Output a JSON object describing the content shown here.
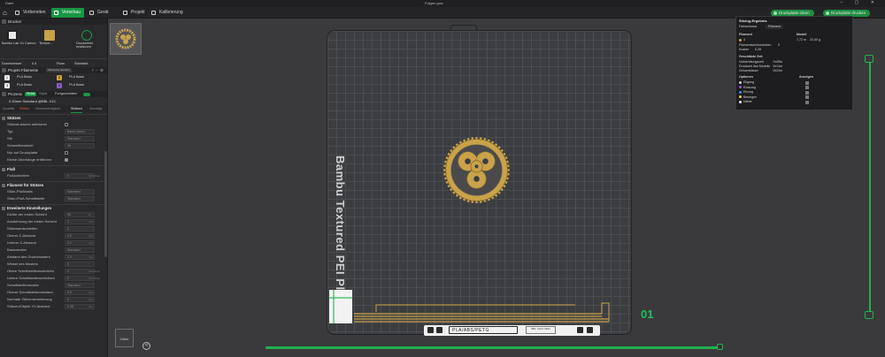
{
  "window": {
    "menu_label": "Datei",
    "title": "Folgen.gcw",
    "controls": "– ▢ ✕"
  },
  "nav": {
    "tabs": [
      {
        "label": "Vorbereiten",
        "active": false
      },
      {
        "label": "Vorschau",
        "active": true
      },
      {
        "label": "Gerät",
        "active": false
      },
      {
        "label": "Projekt",
        "active": false
      },
      {
        "label": "Kalibrierung",
        "active": false
      }
    ],
    "slice_button": "Druckplatte slicen",
    "print_button": "Druckplatte drucken"
  },
  "printer": {
    "section_title": "Drucker",
    "cards": [
      {
        "label": "Bambu Lab X1 Carbon"
      },
      {
        "label": "Texture..."
      },
      {
        "label": "Druckerinfo rmationen"
      }
    ],
    "diameter_label": "Durchmesser",
    "diameter_value": "0.4",
    "flow_label": "Fluss",
    "flow_value": "Standard"
  },
  "filament": {
    "section_title": "Projekt Filamente",
    "badge": "Filamente drucken",
    "items": [
      {
        "num": "1",
        "name": "PLA Basic",
        "color": "#f0f0f0"
      },
      {
        "num": "2",
        "name": "PLA Basic",
        "color": "#c7a23a"
      },
      {
        "num": "3",
        "name": "PLA Basic",
        "color": "#f0f0f0"
      },
      {
        "num": "4",
        "name": "PLA Basic",
        "color": "#8a5cc7"
      }
    ]
  },
  "process": {
    "section_title": "Prozess",
    "global_label": "Global",
    "object_label": "Objekt",
    "advanced_label": "Fortgeschritten",
    "profile": "0.20mm Standard @BBL X1C",
    "tabs": [
      "Qualität",
      "Stärke",
      "Geschwindigkeit",
      "Stützen",
      "Sonstige"
    ],
    "active_tab": "Stützen"
  },
  "supports": {
    "group_title": "Stützen",
    "rows": [
      {
        "label": "Stützstrukturen aktivieren",
        "type": "check",
        "value": ""
      },
      {
        "label": "Typ",
        "type": "value",
        "value": "Baum (auto)"
      },
      {
        "label": "Stil",
        "type": "value",
        "value": "Standard"
      },
      {
        "label": "Schwellenwinkel",
        "type": "value",
        "value": "30"
      },
      {
        "label": "Nur auf Druckplatte",
        "type": "check",
        "value": ""
      },
      {
        "label": "Kleine Überhänge entfernen",
        "type": "check-on",
        "value": ""
      }
    ]
  },
  "raft": {
    "group_title": "Floß",
    "rows": [
      {
        "label": "Floßschichten",
        "type": "value",
        "value": "0",
        "unit": "Schichten"
      }
    ]
  },
  "support_filament": {
    "group_title": "Filament für Stützen",
    "rows": [
      {
        "label": "Stütz-/Floßbasis",
        "type": "value",
        "value": "Standard"
      },
      {
        "label": "Stütz-/Floß-Schnittstelle",
        "type": "value",
        "value": "Standard"
      }
    ]
  },
  "advanced": {
    "group_title": "Erweiterte Einstellungen",
    "rows": [
      {
        "label": "Dichte der ersten Schicht",
        "type": "value",
        "value": "90",
        "unit": "%"
      },
      {
        "label": "Ausdehnung der ersten Schicht",
        "type": "value",
        "value": "2",
        "unit": "mm"
      },
      {
        "label": "Stützwandschleifen",
        "type": "value",
        "value": "0"
      },
      {
        "label": "Oberer Z-Abstand",
        "type": "value",
        "value": "0.2",
        "unit": "mm"
      },
      {
        "label": "Unterer Z-Abstand",
        "type": "value",
        "value": "0.2",
        "unit": "mm"
      },
      {
        "label": "Basismuster",
        "type": "value",
        "value": "Standard"
      },
      {
        "label": "Abstand des Grundmusters",
        "type": "value",
        "value": "2.5",
        "unit": "mm"
      },
      {
        "label": "Winkel des Musters",
        "type": "value",
        "value": "0",
        "unit": "°"
      },
      {
        "label": "Obere Schnittstellenschichten",
        "type": "value",
        "value": "2",
        "unit": "Schichten"
      },
      {
        "label": "Untere Schnittstellenschichten",
        "type": "value",
        "value": "2",
        "unit": "Schichten"
      },
      {
        "label": "Schnittstellenmuster",
        "type": "value",
        "value": "Standard"
      },
      {
        "label": "Oberer Schnittstellenabstand",
        "type": "value",
        "value": "0.5",
        "unit": "mm"
      },
      {
        "label": "Normale Stützenerweiterung",
        "type": "value",
        "value": "0",
        "unit": "mm"
      },
      {
        "label": "Stützen/Objekt XY-Abstand",
        "type": "value",
        "value": "0.35",
        "unit": "mm"
      }
    ]
  },
  "viewport": {
    "plate_label": "Bambu Textured PEI Plate",
    "plate_number": "01",
    "view_cube_label": "Oben",
    "toolbar_text": "PLA/ABS/PETG",
    "toolbar_logo": "BBL SLIM NEW"
  },
  "slicing_results": {
    "title": "Slicing-Ergebnis",
    "tab_filament_label": "Farbschema",
    "tab_filament_value": "Filament",
    "col_filament": "Filament",
    "col_model": "Modell",
    "filament_rows": [
      {
        "label": "4",
        "value_m": "7,72 m",
        "value_g": "23,40 g"
      }
    ],
    "changes_label": "Filamentwechselzeiten",
    "changes_value": "0",
    "cost_label": "Kosten",
    "cost_value": "0,28",
    "time_title": "Geschätzte Zeit",
    "time_rows": [
      {
        "label": "Vorbereitungszeit",
        "value": "7m59s"
      },
      {
        "label": "Druckzeit des Modells",
        "value": "1h14m"
      },
      {
        "label": "Gesamtdauer",
        "value": "1h23m"
      }
    ],
    "options_title": "Optionen",
    "options_col": "Anzeigen",
    "options": [
      {
        "label": "Eilgang",
        "color": "#cfcfcf"
      },
      {
        "label": "Rückzug",
        "color": "#a04be0"
      },
      {
        "label": "Einzug",
        "color": "#3a8ee6"
      },
      {
        "label": "Bewegen",
        "color": "#e8d03a"
      },
      {
        "label": "Nähte",
        "color": "#e6e6e6"
      }
    ]
  },
  "icons": [
    "home-icon",
    "gear-icon",
    "close-icon",
    "chevron-down-icon",
    "plus-icon",
    "trash-icon"
  ]
}
